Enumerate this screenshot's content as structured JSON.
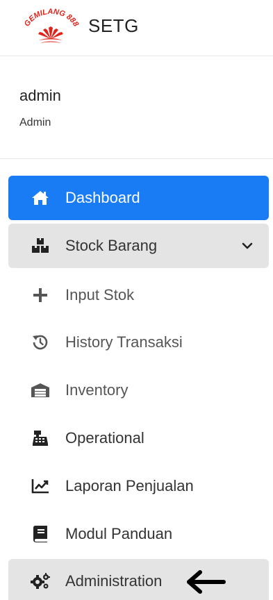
{
  "brand": {
    "logo_text": "GEMILANG 888",
    "title": "SETG"
  },
  "user": {
    "name": "admin",
    "role": "Admin"
  },
  "nav": {
    "dashboard": "Dashboard",
    "stock_barang": "Stock Barang",
    "input_stok": "Input Stok",
    "history_transaksi": "History Transaksi",
    "inventory": "Inventory",
    "operational": "Operational",
    "laporan_penjualan": "Laporan Penjualan",
    "modul_panduan": "Modul Panduan",
    "administration": "Administration"
  },
  "colors": {
    "active": "#1a7cf5",
    "submenu_bg": "#e4e4e4",
    "logo": "#e2231a"
  },
  "icons": {
    "dashboard": "home-icon",
    "stock_barang": "boxes-icon",
    "input_stok": "plus-icon",
    "history_transaksi": "history-icon",
    "inventory": "warehouse-icon",
    "operational": "cash-register-icon",
    "laporan_penjualan": "chart-line-icon",
    "modul_panduan": "book-icon",
    "administration": "cogs-icon",
    "annotation": "arrow-left-icon"
  }
}
